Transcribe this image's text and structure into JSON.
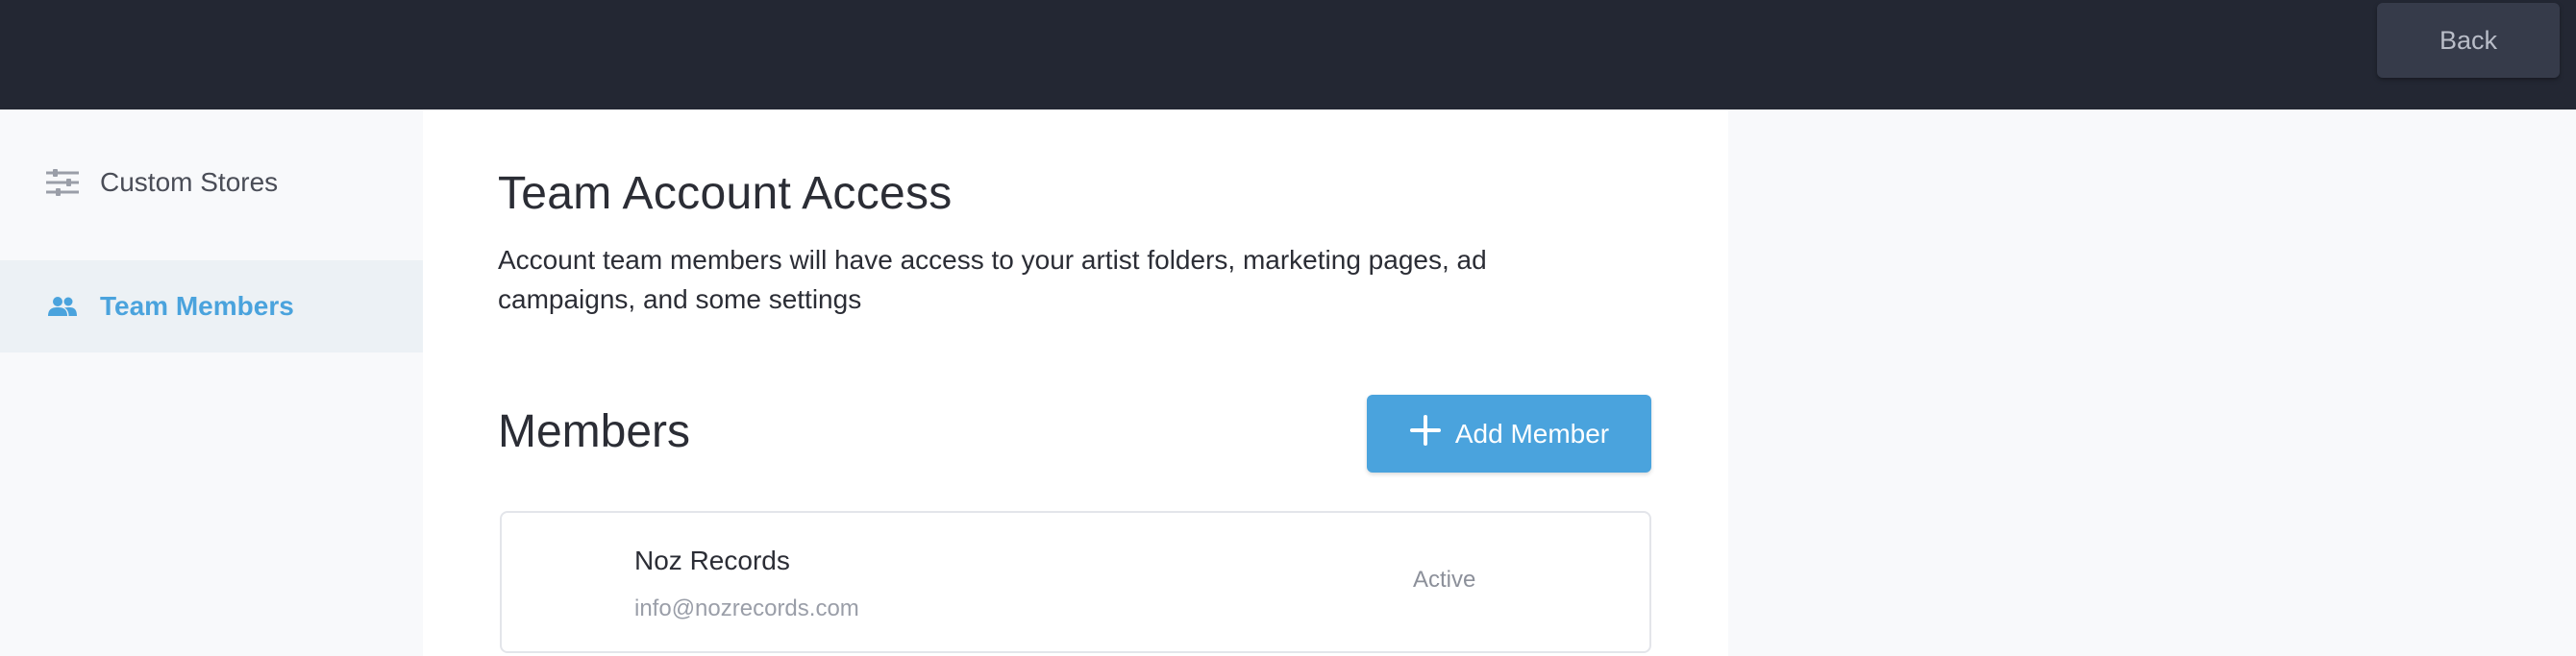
{
  "header": {
    "back_label": "Back"
  },
  "sidebar": {
    "items": [
      {
        "label": "Custom Stores",
        "icon": "sliders-icon",
        "active": false
      },
      {
        "label": "Team Members",
        "icon": "people-icon",
        "active": true
      }
    ]
  },
  "main": {
    "title": "Team Account Access",
    "description": "Account team members will have access to your artist folders, marketing pages, ad campaigns, and some settings",
    "members_section": {
      "title": "Members",
      "add_button_label": "Add Member",
      "add_button_icon": "plus-icon",
      "members": [
        {
          "name": "Noz Records",
          "email": "info@nozrecords.com",
          "status": "Active"
        }
      ]
    }
  },
  "colors": {
    "topbar": "#232733",
    "accent": "#4aa3dd",
    "active_item_bg": "#ecf1f5",
    "page_bg": "#f8f9fb"
  }
}
